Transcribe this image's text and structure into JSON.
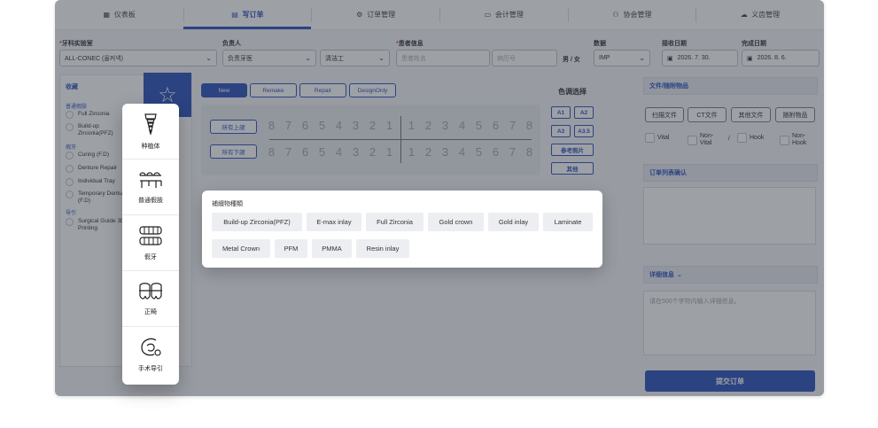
{
  "nav": {
    "tabs": [
      {
        "label": "仪表板",
        "icon": "dashboard-icon"
      },
      {
        "label": "写订单",
        "icon": "document-icon"
      },
      {
        "label": "订单管理",
        "icon": "gear-icon"
      },
      {
        "label": "会计管理",
        "icon": "card-icon"
      },
      {
        "label": "协会管理",
        "icon": "user-icon"
      },
      {
        "label": "义齿管理",
        "icon": "cloud-icon"
      }
    ],
    "active": 1
  },
  "form": {
    "lab_label": "牙科实验室",
    "lab_value": "ALL-CONEC (올커넥)",
    "owner_label": "负责人",
    "owner_value": "负责牙医",
    "cleaner_value": "清洁工",
    "patient_label": "患者信息",
    "patient_name_placeholder": "患者姓名",
    "record_placeholder": "病历号",
    "gender": "男 / 女",
    "data_label": "数据",
    "data_value": "IMP",
    "received_label": "接收日期",
    "received_value": "2026. 7. 30.",
    "completed_label": "完成日期",
    "completed_value": "2026. 8. 6."
  },
  "favorites": {
    "title": "收藏",
    "sections": [
      {
        "name": "普通假肢",
        "items": [
          "Full Zirconia",
          "Build-up Zirconia(PFZ)"
        ]
      },
      {
        "name": "假牙",
        "items": [
          "Curing (F.D)",
          "Denture Repair",
          "Individual Tray",
          "Temporary Denture (F.D)"
        ]
      },
      {
        "name": "导引",
        "items": [
          "Surgical Guide 3D Printing"
        ]
      }
    ]
  },
  "order_types": [
    "New",
    "Remake",
    "Repair",
    "DesignOnly"
  ],
  "teeth": {
    "upper_all": "所有上颌",
    "lower_all": "所有下颌",
    "left": [
      "8",
      "7",
      "6",
      "5",
      "4",
      "3",
      "2",
      "1"
    ],
    "right": [
      "1",
      "2",
      "3",
      "4",
      "5",
      "6",
      "7",
      "8"
    ]
  },
  "shade": {
    "title": "色调选择",
    "buttons": [
      "A1",
      "A2",
      "A3",
      "A3.5"
    ],
    "ref_photo": "参考照片",
    "other": "其他"
  },
  "files": {
    "title": "文件/随附物品",
    "buttons": [
      "扫描文件",
      "CT文件",
      "其他文件",
      "随附物品"
    ],
    "options": [
      "Vital",
      "Non-Vital",
      "Hook",
      "Non-Hook"
    ],
    "separator": "/"
  },
  "order_list_title": "订单列表确认",
  "detail": {
    "title": "详细信息",
    "placeholder": "请在500个字符内输入详细信息。"
  },
  "submit_label": "提交订单",
  "categories": [
    {
      "label": "种植体",
      "icon": "implant-icon"
    },
    {
      "label": "普通假肢",
      "icon": "bridge-icon"
    },
    {
      "label": "假牙",
      "icon": "denture-icon"
    },
    {
      "label": "正畸",
      "icon": "braces-icon"
    },
    {
      "label": "手术导引",
      "icon": "surgical-guide-icon"
    }
  ],
  "prosthesis": {
    "title": "補綴物種類",
    "types": [
      "Build-up Zirconia(PFZ)",
      "E-max inlay",
      "Full Zirconia",
      "Gold crown",
      "Gold inlay",
      "Laminate",
      "Metal Crown",
      "PFM",
      "PMMA",
      "Resin inlay"
    ]
  }
}
